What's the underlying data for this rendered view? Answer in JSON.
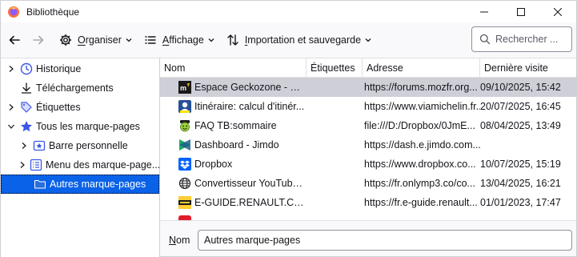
{
  "window": {
    "title": "Bibliothèque"
  },
  "toolbar": {
    "organize": {
      "accesskey": "O",
      "rest": "rganiser"
    },
    "view": {
      "accesskey": "A",
      "rest": "ffichage"
    },
    "import": {
      "accesskey": "I",
      "rest": "mportation et sauvegarde"
    },
    "search_placeholder": "Rechercher ..."
  },
  "sidebar": {
    "items": [
      {
        "label": "Historique",
        "icon": "clock-icon",
        "expandable": true,
        "expanded": false,
        "depth": 0
      },
      {
        "label": "Téléchargements",
        "icon": "download-icon",
        "expandable": false,
        "depth": 0
      },
      {
        "label": "Étiquettes",
        "icon": "tag-icon",
        "expandable": true,
        "expanded": false,
        "depth": 0
      },
      {
        "label": "Tous les marque-pages",
        "icon": "star-icon",
        "expandable": true,
        "expanded": true,
        "depth": 0
      },
      {
        "label": "Barre personnelle",
        "icon": "bookmarks-toolbar-icon",
        "expandable": true,
        "expanded": false,
        "depth": 1
      },
      {
        "label": "Menu des marque-page...",
        "icon": "bookmarks-menu-icon",
        "expandable": true,
        "expanded": false,
        "depth": 1
      },
      {
        "label": "Autres marque-pages",
        "icon": "folder-icon",
        "expandable": false,
        "depth": 1,
        "selected": true
      }
    ]
  },
  "table": {
    "columns": [
      "Nom",
      "Étiquettes",
      "Adresse",
      "Dernière visite"
    ],
    "rows": [
      {
        "name": "Espace Geckozone - Pa...",
        "tags": "",
        "address": "https://forums.mozfr.org...",
        "last_visit": "09/10/2025, 15:42",
        "favicon": "geckozone-favicon",
        "selected": true
      },
      {
        "name": "Itinéraire: calcul d'itinér...",
        "tags": "",
        "address": "https://www.viamichelin.fr...",
        "last_visit": "20/07/2025, 16:45",
        "favicon": "michelin-favicon"
      },
      {
        "name": "FAQ TB:sommaire",
        "tags": "",
        "address": "file:///D:/Dropbox/0JmE...",
        "last_visit": "08/04/2025, 13:49",
        "favicon": "faq-smiley-favicon"
      },
      {
        "name": "Dashboard - Jimdo",
        "tags": "",
        "address": "https://dash.e.jimdo.com...",
        "last_visit": "",
        "favicon": "jimdo-favicon"
      },
      {
        "name": "Dropbox",
        "tags": "",
        "address": "https://www.dropbox.co...",
        "last_visit": "10/07/2025, 15:19",
        "favicon": "dropbox-favicon"
      },
      {
        "name": "Convertisseur YouTube ...",
        "tags": "",
        "address": "https://fr.onlymp3.co/co...",
        "last_visit": "13/04/2025, 16:21",
        "favicon": "globe-favicon"
      },
      {
        "name": "E-GUIDE.RENAULT.CO...",
        "tags": "",
        "address": "https://fr.e-guide.renault...",
        "last_visit": "01/01/2023, 17:47",
        "favicon": "renault-favicon"
      }
    ]
  },
  "details": {
    "label_accesskey": "N",
    "label_rest": "om",
    "name_value": "Autres marque-pages"
  },
  "colors": {
    "selection_blue": "#0a62e8",
    "row_selected_grey": "#cfcfd8",
    "star_blue": "#3a57e8",
    "folder_blue": "#2a6fdb"
  }
}
